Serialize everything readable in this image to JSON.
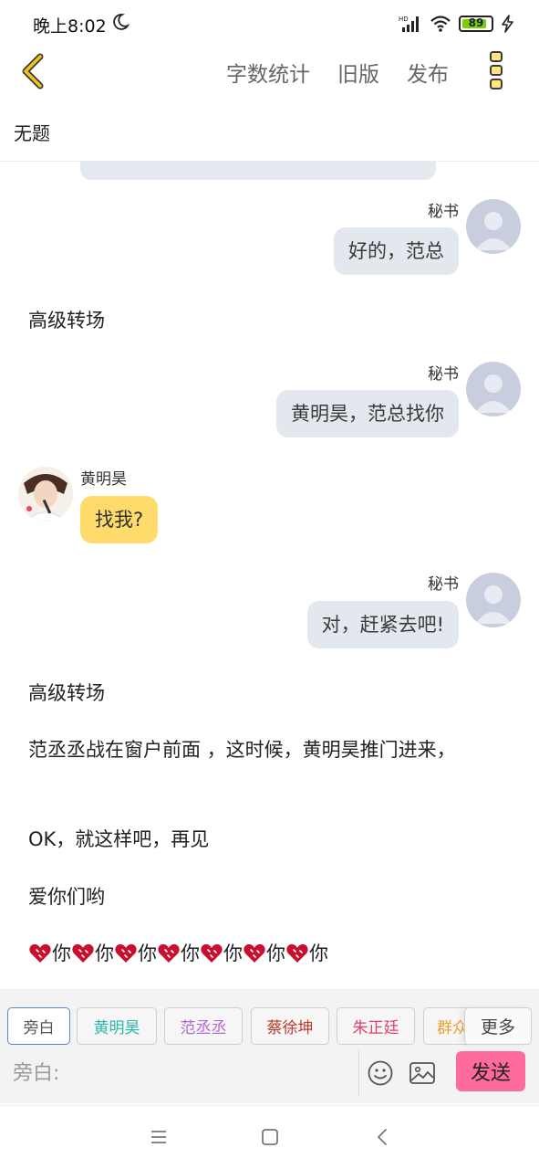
{
  "status_bar": {
    "time": "晚上8:02",
    "network": "HD",
    "battery": 89,
    "battery_label": "89",
    "colors": {
      "battery_fill": "#7dd000"
    }
  },
  "header": {
    "back_icon": "chevron-left-icon",
    "actions": [
      "字数统计",
      "旧版",
      "发布"
    ],
    "menu_icon": "vertical-dots-icon",
    "accent": "#f0c419"
  },
  "document": {
    "title": "无题"
  },
  "chat": {
    "msg1": {
      "speaker": "秘书",
      "text": "好的，范总"
    },
    "narr1": "高级转场",
    "msg2": {
      "speaker": "秘书",
      "text": "黄明昊，范总找你"
    },
    "msg3": {
      "speaker": "黄明昊",
      "text": "找我?"
    },
    "msg4": {
      "speaker": "秘书",
      "text": "对，赶紧去吧!"
    },
    "narr2": "高级转场",
    "narr3": "范丞丞战在窗户前面 ，这时候，黄明昊推门进来，",
    "narr4": "OK，就这样吧，再见",
    "narr5": "爱你们哟",
    "narr6": [
      "你",
      "你",
      "你",
      "你",
      "你",
      "你",
      "你"
    ],
    "colors": {
      "right_bubble": "#e3e7ee",
      "left_bubble": "#ffdb6b",
      "heart": "#c8102e"
    }
  },
  "bottom": {
    "roles": [
      {
        "label": "旁白",
        "color": "#555555"
      },
      {
        "label": "黄明昊",
        "color": "#2ab7b0"
      },
      {
        "label": "范丞丞",
        "color": "#b06ad0"
      },
      {
        "label": "蔡徐坤",
        "color": "#c0392b"
      },
      {
        "label": "朱正廷",
        "color": "#e0406a"
      },
      {
        "label": "群众",
        "color": "#f0a030"
      }
    ],
    "more_label": "更多",
    "input_placeholder": "旁白:",
    "send_label": "发送",
    "send_color": "#ff6a9e"
  },
  "nav": {
    "icons": [
      "menu-icon",
      "home-icon",
      "back-icon"
    ]
  }
}
